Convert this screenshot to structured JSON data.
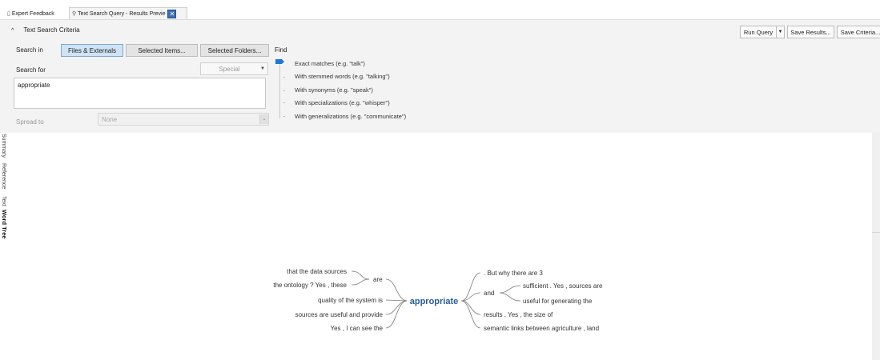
{
  "tabs": [
    {
      "label": "Expert Feedback",
      "icon": "document-icon"
    },
    {
      "label": "Text Search Query - Results Previe",
      "icon": "search-icon",
      "active": true
    }
  ],
  "criteria": {
    "header": "Text Search Criteria",
    "run_query": "Run Query",
    "save_results": "Save Results...",
    "save_criteria": "Save Criteria...",
    "search_in_label": "Search in",
    "scope_buttons": [
      "Files & Externals",
      "Selected Items...",
      "Selected Folders..."
    ],
    "find_label": "Find",
    "search_for_label": "Search for",
    "special_label": "Special",
    "search_text": "appropriate",
    "spread_to_label": "Spread to",
    "spread_value": "None",
    "find_options": [
      "Exact matches (e.g. \"talk\")",
      "With stemmed words (e.g. \"talking\")",
      "With synonyms (e.g. \"speak\")",
      "With specializations (e.g. \"whisper\")",
      "With generalizations (e.g. \"communicate\")"
    ],
    "find_selected_index": 0
  },
  "side_tabs": [
    "Summary",
    "Reference",
    "Text",
    "Word Tree"
  ],
  "side_tab_active": "Word Tree",
  "word_tree": {
    "center": "appropriate",
    "left": {
      "group_connector": "are",
      "group_items": [
        "that the data sources",
        "the ontology ? Yes , these"
      ],
      "items": [
        "quality of the system is",
        "sources are useful and provide",
        "Yes , I can see the"
      ]
    },
    "right": {
      "items_top": [
        ". But why there are 3"
      ],
      "group_connector": "and",
      "group_items": [
        "sufficient . Yes , sources are",
        "useful for generating the"
      ],
      "items_bottom": [
        "results . Yes , the size of",
        "semantic links between agriculture , land"
      ]
    }
  },
  "colors": {
    "accent": "#1f78d1",
    "center_word": "#2a5d9a",
    "active_button": "#cfe3f5"
  }
}
